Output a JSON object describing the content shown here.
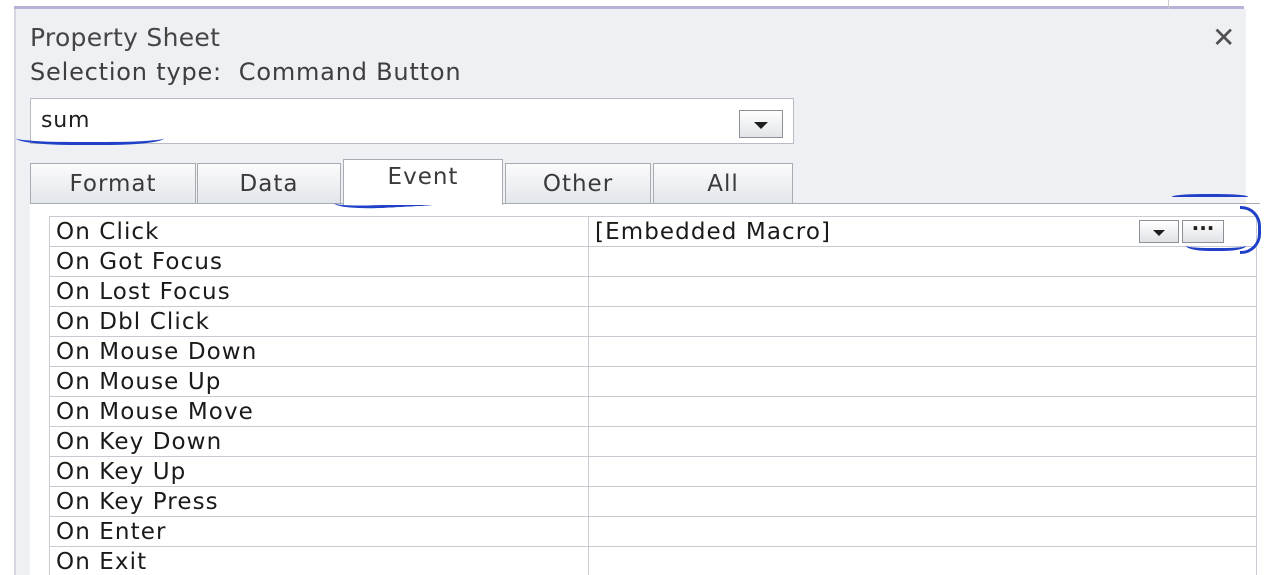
{
  "panel": {
    "title": "Property Sheet",
    "close_glyph": "✕",
    "selection_type": "Selection type:  Command Button"
  },
  "selector": {
    "value": "sum",
    "dropdown_icon": "chevron-down-icon"
  },
  "tabs": [
    {
      "label": "Format",
      "active": false
    },
    {
      "label": "Data",
      "active": false
    },
    {
      "label": "Event",
      "active": true
    },
    {
      "label": "Other",
      "active": false
    },
    {
      "label": "All",
      "active": false
    }
  ],
  "properties": [
    {
      "name": "On Click",
      "value": "[Embedded Macro]"
    },
    {
      "name": "On Got Focus",
      "value": ""
    },
    {
      "name": "On Lost Focus",
      "value": ""
    },
    {
      "name": "On Dbl Click",
      "value": ""
    },
    {
      "name": "On Mouse Down",
      "value": ""
    },
    {
      "name": "On Mouse Up",
      "value": ""
    },
    {
      "name": "On Mouse Move",
      "value": ""
    },
    {
      "name": "On Key Down",
      "value": ""
    },
    {
      "name": "On Key Up",
      "value": ""
    },
    {
      "name": "On Key Press",
      "value": ""
    },
    {
      "name": "On Enter",
      "value": ""
    },
    {
      "name": "On Exit",
      "value": ""
    }
  ],
  "builder_button_glyph": "···",
  "annotation_color": "#2040c8"
}
